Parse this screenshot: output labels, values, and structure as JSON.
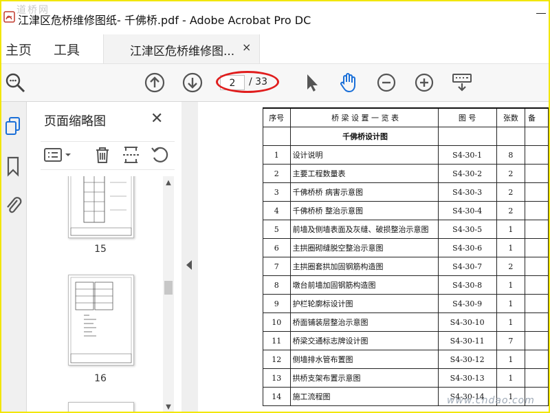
{
  "window": {
    "title": "江津区危桥维修图纸- 千佛桥.pdf - Adobe Acrobat Pro DC",
    "watermark": "道桥网"
  },
  "tabs": {
    "home": "主页",
    "tools": "工具",
    "document": "江津区危桥维修图...",
    "close": "×"
  },
  "toolbar": {
    "page_current": "2",
    "page_total": "/ 33",
    "icons": [
      "search-icon",
      "page-up-icon",
      "page-down-icon",
      "select-cursor-icon",
      "hand-icon",
      "zoom-out-icon",
      "zoom-in-icon",
      "keyboard-icon"
    ]
  },
  "rail": {
    "icons": [
      "page-thumbnails-icon",
      "bookmark-icon",
      "attachment-icon"
    ]
  },
  "thumbnails": {
    "title": "页面缩略图",
    "close": "✕",
    "tools": [
      "options-menu-icon",
      "delete-icon",
      "extract-icon",
      "rotate-icon"
    ],
    "pages": [
      {
        "label": "15"
      },
      {
        "label": "16"
      }
    ]
  },
  "table": {
    "header": {
      "no": "序号",
      "name": "桥 梁 设 置 一 览 表",
      "code": "图   号",
      "sheets": "张数",
      "note": "备"
    },
    "section": "千佛桥设计图",
    "rows": [
      {
        "no": "1",
        "name": "设计说明",
        "code": "S4-30-1",
        "sheets": "8"
      },
      {
        "no": "2",
        "name": "主要工程数量表",
        "code": "S4-30-2",
        "sheets": "2"
      },
      {
        "no": "3",
        "name": "千佛桥桥  病害示意图",
        "code": "S4-30-3",
        "sheets": "2"
      },
      {
        "no": "4",
        "name": "千佛桥桥  整治示意图",
        "code": "S4-30-4",
        "sheets": "2"
      },
      {
        "no": "5",
        "name": "前墙及侧墙表面及灰缝、破损整治示意图",
        "code": "S4-30-5",
        "sheets": "1"
      },
      {
        "no": "6",
        "name": "主拱圈砌缝脱空整治示意图",
        "code": "S4-30-6",
        "sheets": "1"
      },
      {
        "no": "7",
        "name": "主拱圈套拱加固钢筋构造图",
        "code": "S4-30-7",
        "sheets": "2"
      },
      {
        "no": "8",
        "name": "墩台前墙加固钢筋构造图",
        "code": "S4-30-8",
        "sheets": "1"
      },
      {
        "no": "9",
        "name": "护栏轮廓标设计图",
        "code": "S4-30-9",
        "sheets": "1"
      },
      {
        "no": "10",
        "name": "桥面铺装层整治示意图",
        "code": "S4-30-10",
        "sheets": "1"
      },
      {
        "no": "11",
        "name": "桥梁交通标志牌设计图",
        "code": "S4-30-11",
        "sheets": "7"
      },
      {
        "no": "12",
        "name": "侧墙排水管布置图",
        "code": "S4-30-12",
        "sheets": "1"
      },
      {
        "no": "13",
        "name": "拱桥支架布置示意图",
        "code": "S4-30-13",
        "sheets": "1"
      },
      {
        "no": "14",
        "name": "施工流程图",
        "code": "S4-30-14",
        "sheets": "1"
      }
    ]
  },
  "footer_watermark": "www.cndao.com",
  "colors": {
    "annotation": "#e01d1d",
    "frame": "#f2e600",
    "accent": "#1a6fd8"
  }
}
